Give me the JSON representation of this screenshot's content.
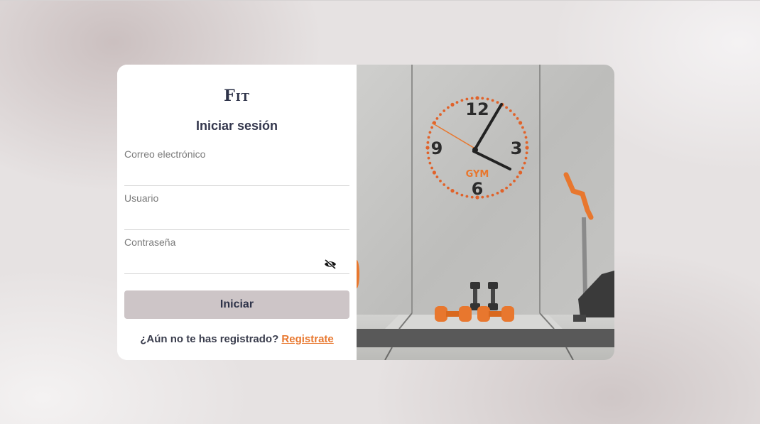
{
  "brand": {
    "logo_text": "Fit"
  },
  "login": {
    "title": "Iniciar sesión",
    "fields": {
      "email": {
        "label": "Correo electrónico",
        "value": ""
      },
      "user": {
        "label": "Usuario",
        "value": ""
      },
      "password": {
        "label": "Contraseña",
        "value": "",
        "toggle_icon": "eye-slash-icon"
      }
    },
    "submit_label": "Iniciar",
    "signup_prompt": "¿Aún no te has registrado?",
    "signup_link": "Registrate"
  },
  "hero_image": {
    "clock_numbers": [
      "12",
      "3",
      "6",
      "9"
    ],
    "clock_logo": "GYM"
  },
  "colors": {
    "accent": "#e8772e",
    "text_dark": "#2e3349",
    "button_bg": "#cdc5c7"
  }
}
